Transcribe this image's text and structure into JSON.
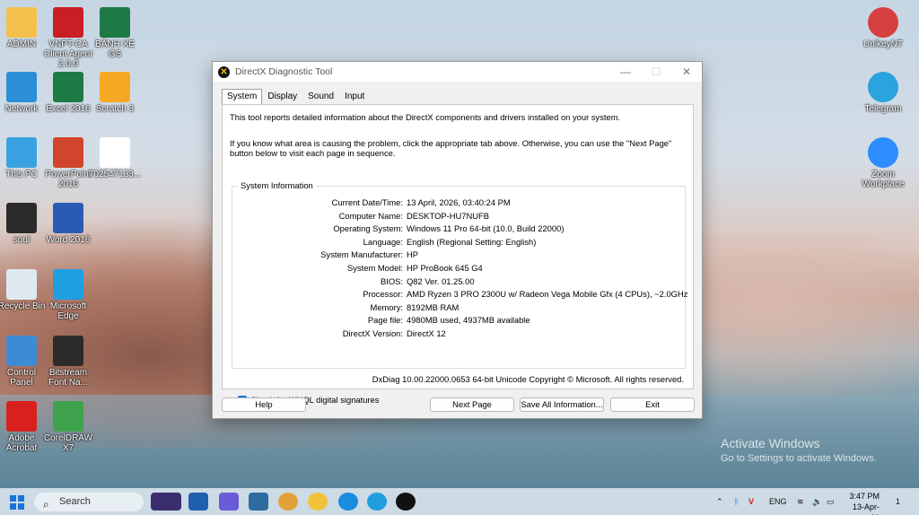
{
  "desktop": {
    "left_icons": [
      {
        "label": "ADMIN",
        "icon": "folder-icon",
        "color": "#f3c14b"
      },
      {
        "label": "VNPT-CA Client Agent 2.0.0",
        "icon": "vnpt-icon",
        "color": "#c81e24"
      },
      {
        "label": "BẢNH XE GS",
        "icon": "excel-file-icon",
        "color": "#1e7a45"
      },
      {
        "label": "Network",
        "icon": "network-icon",
        "color": "#2a8fd6"
      },
      {
        "label": "Excel 2016",
        "icon": "excel-icon",
        "color": "#1e7a45"
      },
      {
        "label": "Scratch 3",
        "icon": "scratch-icon",
        "color": "#f7a823"
      },
      {
        "label": "This PC",
        "icon": "computer-icon",
        "color": "#3aa1e0"
      },
      {
        "label": "PowerPoint 2016",
        "icon": "powerpoint-icon",
        "color": "#d0452b"
      },
      {
        "label": "702547133...",
        "icon": "document-icon",
        "color": "#ffffff"
      },
      {
        "label": "soul",
        "icon": "powerpoint-file-icon",
        "color": "#2b2b2b"
      },
      {
        "label": "Word 2016",
        "icon": "word-icon",
        "color": "#2a5bb4"
      },
      {
        "label": "Recycle Bin",
        "icon": "recycle-bin-icon",
        "color": "#dfe9f2"
      },
      {
        "label": "Microsoft Edge",
        "icon": "edge-icon",
        "color": "#1f9ee0"
      },
      {
        "label": "Control Panel",
        "icon": "control-panel-icon",
        "color": "#3d8bd4"
      },
      {
        "label": "Bitstream Font Na...",
        "icon": "font-icon",
        "color": "#2b2b2b"
      },
      {
        "label": "Adobe Acrobat",
        "icon": "acrobat-icon",
        "color": "#d8211d"
      },
      {
        "label": "CorelDRAW X7",
        "icon": "coreldraw-icon",
        "color": "#3fa34d"
      }
    ],
    "right_icons": [
      {
        "label": "UnikeyNT",
        "icon": "unikey-icon",
        "color": "#d64040"
      },
      {
        "label": "Telegram",
        "icon": "telegram-icon",
        "color": "#2aa3df"
      },
      {
        "label": "Zoom Workplace",
        "icon": "zoom-icon",
        "color": "#2d8cff"
      }
    ],
    "watermark": {
      "line1": "Activate Windows",
      "line2": "Go to Settings to activate Windows."
    }
  },
  "window": {
    "title": "DirectX Diagnostic Tool",
    "controls": {
      "minimize": "—",
      "maximize": "☐",
      "close": "✕"
    },
    "tabs": [
      {
        "label": "System",
        "active": true
      },
      {
        "label": "Display",
        "active": false
      },
      {
        "label": "Sound",
        "active": false
      },
      {
        "label": "Input",
        "active": false
      }
    ],
    "intro1": "This tool reports detailed information about the DirectX components and drivers installed on your system.",
    "intro2": "If you know what area is causing the problem, click the appropriate tab above.  Otherwise, you can use the \"Next Page\" button below to visit each page in sequence.",
    "group_label": "System Information",
    "rows": [
      {
        "key": "Current Date/Time:",
        "value": "13 April, 2026, 03:40:24 PM"
      },
      {
        "key": "Computer Name:",
        "value": "DESKTOP-HU7NUFB"
      },
      {
        "key": "Operating System:",
        "value": "Windows 11 Pro 64-bit (10.0, Build 22000)"
      },
      {
        "key": "Language:",
        "value": "English (Regional Setting: English)"
      },
      {
        "key": "System Manufacturer:",
        "value": "HP"
      },
      {
        "key": "System Model:",
        "value": "HP ProBook 645 G4"
      },
      {
        "key": "BIOS:",
        "value": "Q82 Ver. 01.25.00"
      },
      {
        "key": "Processor:",
        "value": "AMD Ryzen 3 PRO 2300U w/ Radeon Vega Mobile Gfx  (4 CPUs), ~2.0GHz"
      },
      {
        "key": "Memory:",
        "value": "8192MB RAM"
      },
      {
        "key": "Page file:",
        "value": "4980MB used, 4937MB available"
      },
      {
        "key": "DirectX Version:",
        "value": "DirectX 12"
      }
    ],
    "checkbox": {
      "label": "Check for WHQL digital signatures",
      "checked": true
    },
    "footer": "DxDiag 10.00.22000.0653 64-bit Unicode  Copyright © Microsoft. All rights reserved.",
    "buttons": {
      "help": "Help",
      "next": "Next Page",
      "save": "Save All Information...",
      "exit": "Exit"
    }
  },
  "taskbar": {
    "search_placeholder": "Search",
    "apps": [
      "widgets-icon",
      "task-view-icon",
      "snipping-tool-icon",
      "calculator-icon",
      "chrome-icon",
      "file-explorer-icon",
      "zalo-icon",
      "edge-icon",
      "directx-icon"
    ],
    "tray": {
      "language": "ENG",
      "time": "3:47 PM",
      "date": "13-Apr-26",
      "notification_count": "1"
    }
  }
}
